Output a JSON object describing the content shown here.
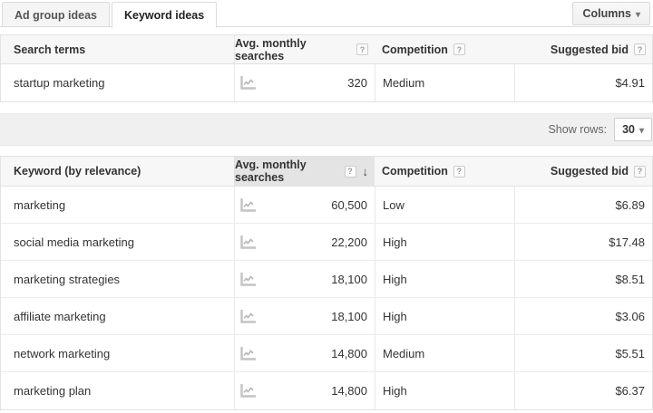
{
  "tabs": [
    {
      "label": "Ad group ideas",
      "active": false
    },
    {
      "label": "Keyword ideas",
      "active": true
    }
  ],
  "columns_button": {
    "label": "Columns"
  },
  "ui": {
    "help_glyph": "?",
    "dropdown_arrow": "▾",
    "sort_arrow": "↓"
  },
  "search_terms_table": {
    "headers": {
      "term": "Search terms",
      "searches": "Avg. monthly searches",
      "competition": "Competition",
      "bid": "Suggested bid"
    },
    "rows": [
      {
        "term": "startup marketing",
        "searches": "320",
        "competition": "Medium",
        "bid": "$4.91"
      }
    ]
  },
  "show_rows": {
    "label": "Show rows:",
    "value": "30"
  },
  "keyword_table": {
    "headers": {
      "keyword": "Keyword (by relevance)",
      "searches": "Avg. monthly searches",
      "competition": "Competition",
      "bid": "Suggested bid"
    },
    "sorted_column": "searches",
    "rows": [
      {
        "keyword": "marketing",
        "searches": "60,500",
        "competition": "Low",
        "bid": "$6.89"
      },
      {
        "keyword": "social media marketing",
        "searches": "22,200",
        "competition": "High",
        "bid": "$17.48"
      },
      {
        "keyword": "marketing strategies",
        "searches": "18,100",
        "competition": "High",
        "bid": "$8.51"
      },
      {
        "keyword": "affiliate marketing",
        "searches": "18,100",
        "competition": "High",
        "bid": "$3.06"
      },
      {
        "keyword": "network marketing",
        "searches": "14,800",
        "competition": "Medium",
        "bid": "$5.51"
      },
      {
        "keyword": "marketing plan",
        "searches": "14,800",
        "competition": "High",
        "bid": "$6.37"
      }
    ]
  },
  "colors": {
    "header_bg": "#f7f7f7",
    "sorted_header_bg": "#e4e4e4",
    "band_bg": "#f0f0f0",
    "table_border": "#e2e2e2",
    "tab_inactive_bg": "#f5f5f5"
  }
}
